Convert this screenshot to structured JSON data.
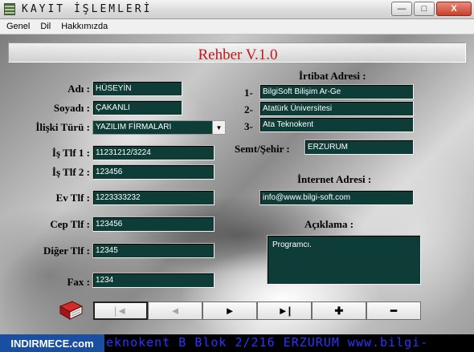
{
  "window": {
    "title": "KAYIT İŞLEMLERİ",
    "minimize": "—",
    "maximize": "□",
    "close": "X"
  },
  "menu": [
    "Genel",
    "Dil",
    "Hakkımızda"
  ],
  "app_heading": "Rehber V.1.0",
  "form": {
    "adi_label": "Adı :",
    "adi_value": "HÜSEYİN",
    "soyadi_label": "Soyadı :",
    "soyadi_value": "ÇAKANLI",
    "iliski_label": "İlişki Türü :",
    "iliski_value": "YAZILIM FİRMALARI",
    "is_tlf1_label": "İş Tlf 1 :",
    "is_tlf1_value": "11231212/3224",
    "is_tlf2_label": "İş Tlf 2 :",
    "is_tlf2_value": "123456",
    "ev_tlf_label": "Ev Tlf :",
    "ev_tlf_value": "1223333232",
    "cep_tlf_label": "Cep Tlf :",
    "cep_tlf_value": "123456",
    "diger_tlf_label": "Diğer Tlf :",
    "diger_tlf_value": "12345",
    "fax_label": "Fax :",
    "fax_value": "1234"
  },
  "address": {
    "heading": "İrtibat Adresi :",
    "line1_num": "1-",
    "line1": "BilgiSoft Bilişim Ar-Ge",
    "line2_num": "2-",
    "line2": "Atatürk Üniversitesi",
    "line3_num": "3-",
    "line3": "Ata Teknokent",
    "semt_label": "Semt/Şehir :",
    "semt_value": "ERZURUM"
  },
  "internet": {
    "heading": "İnternet Adresi :",
    "value": "info@www.bilgi-soft.com"
  },
  "aciklama": {
    "heading": "Açıklama :",
    "value": "Programcı."
  },
  "nav": {
    "first": "|◄",
    "prev": "◄",
    "next": "►",
    "last": "►|",
    "add": "✚",
    "delete": "━"
  },
  "status": {
    "ticker": "eknokent B Blok 2/216 ERZURUM www.bilgi-",
    "watermark": "INDIRMECE.com"
  }
}
